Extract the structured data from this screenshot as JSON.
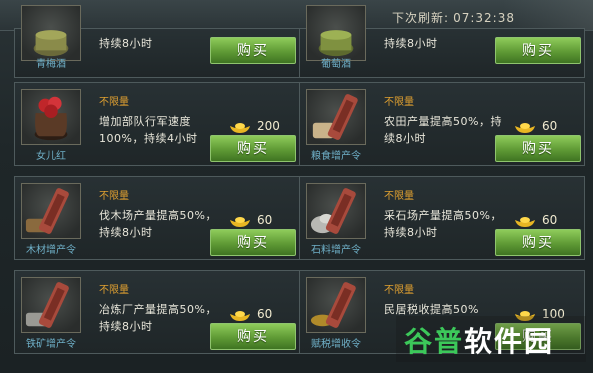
{
  "header": {
    "refresh_label": "下次刷新:",
    "refresh_time": "07:32:38"
  },
  "items": [
    {
      "name": "青梅酒",
      "limit": "",
      "desc": "持续8小时",
      "price": "",
      "buy": "购买",
      "icon": "green-wine-jar-icon"
    },
    {
      "name": "葡萄酒",
      "limit": "",
      "desc": "持续8小时",
      "price": "",
      "buy": "购买",
      "icon": "grape-wine-jar-icon"
    },
    {
      "name": "女儿红",
      "limit": "不限量",
      "desc": "增加部队行军速度100%，持续4小时",
      "price": "200",
      "buy": "购买",
      "icon": "red-wine-jar-icon"
    },
    {
      "name": "粮食增产令",
      "limit": "不限量",
      "desc": "农田产量提高50%，持续8小时",
      "price": "60",
      "buy": "购买",
      "icon": "grain-token-icon"
    },
    {
      "name": "木材增产令",
      "limit": "不限量",
      "desc": "伐木场产量提高50%，持续8小时",
      "price": "60",
      "buy": "购买",
      "icon": "wood-token-icon"
    },
    {
      "name": "石料增产令",
      "limit": "不限量",
      "desc": "采石场产量提高50%，持续8小时",
      "price": "60",
      "buy": "购买",
      "icon": "stone-token-icon"
    },
    {
      "name": "铁矿增产令",
      "limit": "不限量",
      "desc": "冶炼厂产量提高50%，持续8小时",
      "price": "60",
      "buy": "购买",
      "icon": "iron-token-icon"
    },
    {
      "name": "赋税增收令",
      "limit": "不限量",
      "desc": "民居税收提高50%",
      "price": "100",
      "buy": "购买",
      "icon": "tax-token-icon"
    }
  ],
  "watermark": {
    "part1": "谷普",
    "part2": "软件园"
  }
}
